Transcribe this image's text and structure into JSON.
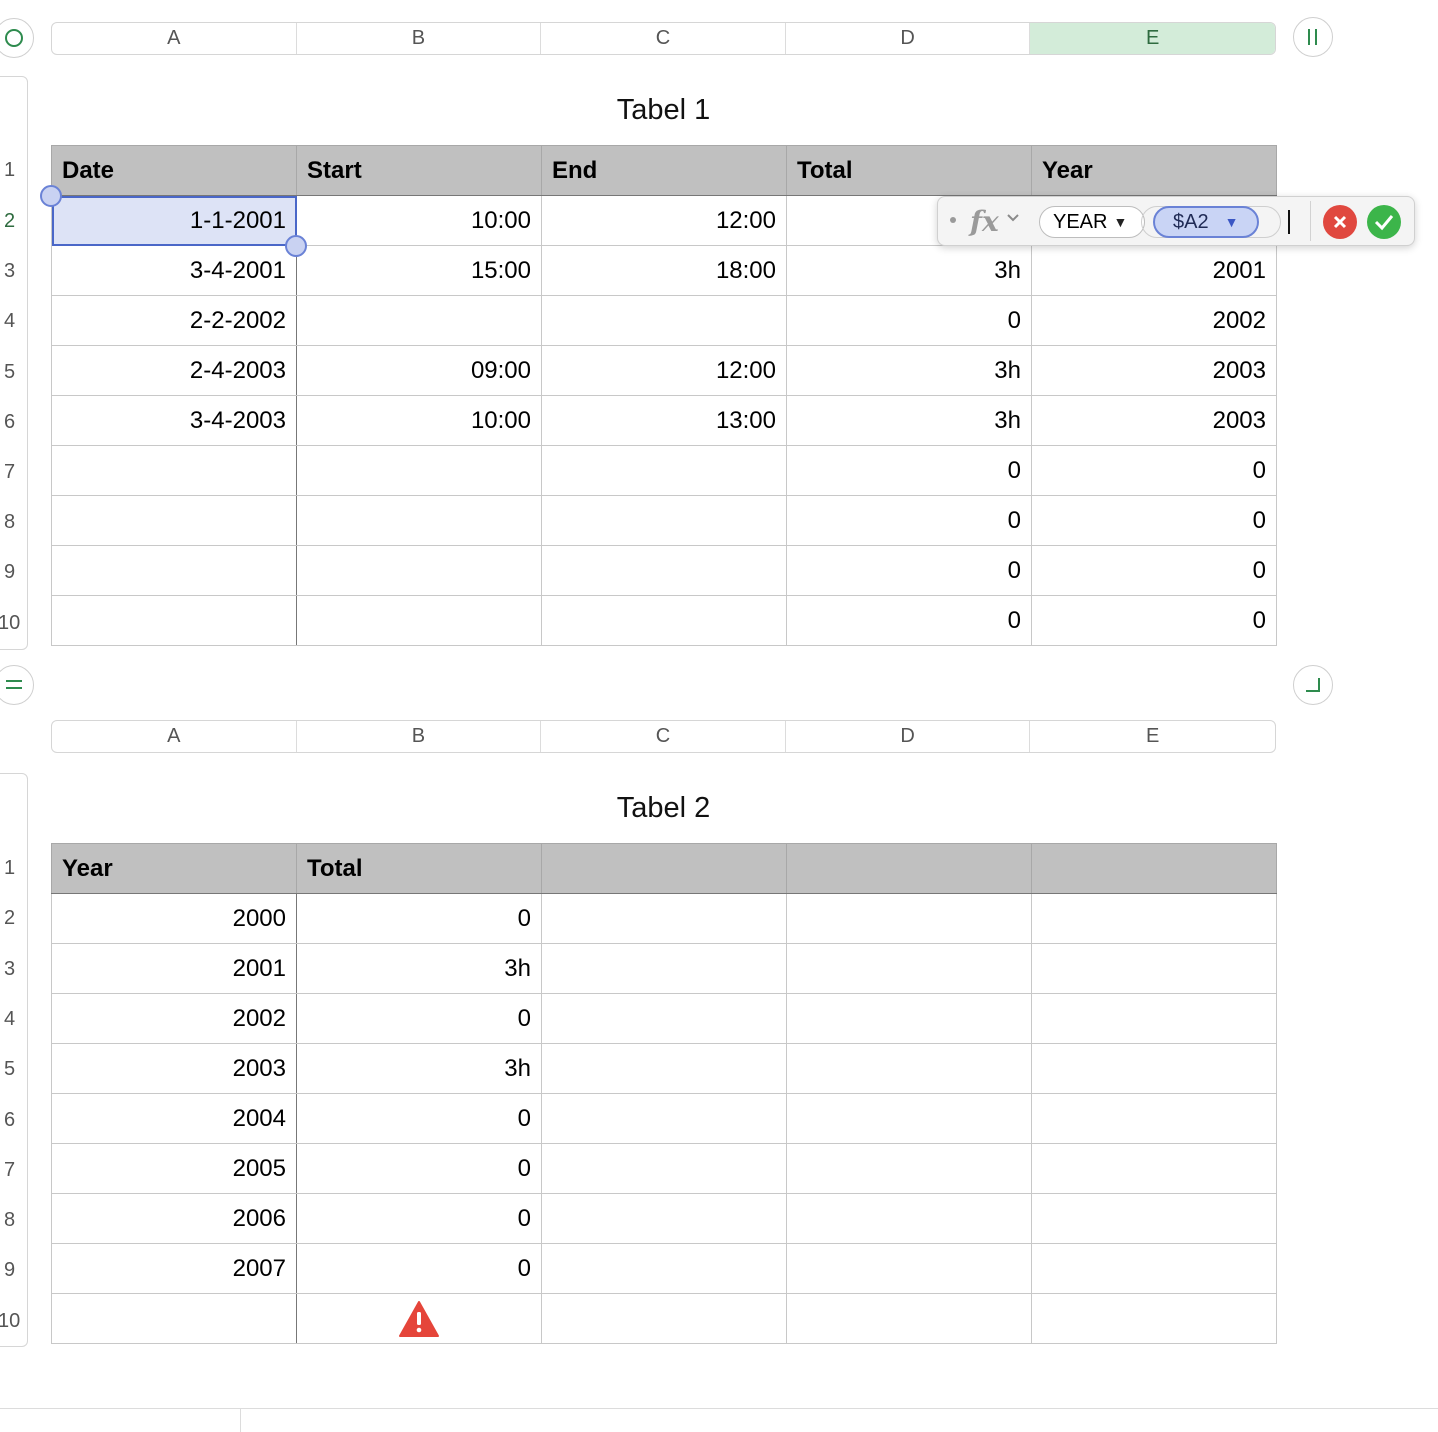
{
  "sheet": {
    "columns": [
      "A",
      "B",
      "C",
      "D",
      "E"
    ],
    "table1": {
      "title": "Tabel 1",
      "row_numbers": [
        "1",
        "2",
        "3",
        "4",
        "5",
        "6",
        "7",
        "8",
        "9",
        "10"
      ],
      "header": [
        "Date",
        "Start",
        "End",
        "Total",
        "Year"
      ],
      "rows": [
        [
          "1-1-2001",
          "10:00",
          "12:00",
          "",
          ""
        ],
        [
          "3-4-2001",
          "15:00",
          "18:00",
          "3h",
          "2001"
        ],
        [
          "2-2-2002",
          "",
          "",
          "0",
          "2002"
        ],
        [
          "2-4-2003",
          "09:00",
          "12:00",
          "3h",
          "2003"
        ],
        [
          "3-4-2003",
          "10:00",
          "13:00",
          "3h",
          "2003"
        ],
        [
          "",
          "",
          "",
          "0",
          "0"
        ],
        [
          "",
          "",
          "",
          "0",
          "0"
        ],
        [
          "",
          "",
          "",
          "0",
          "0"
        ],
        [
          "",
          "",
          "",
          "0",
          "0"
        ]
      ]
    },
    "table2": {
      "title": "Tabel 2",
      "row_numbers": [
        "1",
        "2",
        "3",
        "4",
        "5",
        "6",
        "7",
        "8",
        "9",
        "10"
      ],
      "header": [
        "Year",
        "Total",
        "",
        "",
        ""
      ],
      "rows": [
        [
          "2000",
          "0",
          "",
          "",
          ""
        ],
        [
          "2001",
          "3h",
          "",
          "",
          ""
        ],
        [
          "2002",
          "0",
          "",
          "",
          ""
        ],
        [
          "2003",
          "3h",
          "",
          "",
          ""
        ],
        [
          "2004",
          "0",
          "",
          "",
          ""
        ],
        [
          "2005",
          "0",
          "",
          "",
          ""
        ],
        [
          "2006",
          "0",
          "",
          "",
          ""
        ],
        [
          "2007",
          "0",
          "",
          "",
          ""
        ],
        [
          "",
          "",
          "",
          "",
          ""
        ]
      ],
      "warning_icon": "warning-triangle-icon"
    }
  },
  "formula_editor": {
    "fx_label": "fx",
    "function_token": "YEAR",
    "reference_token": "$A2"
  },
  "colors": {
    "selected_column": "#d3ecd9",
    "header_fill": "#c0c0c0",
    "reference_blue": "#4a67c8",
    "cancel_red": "#e0483f",
    "accept_green": "#3cb54a"
  }
}
